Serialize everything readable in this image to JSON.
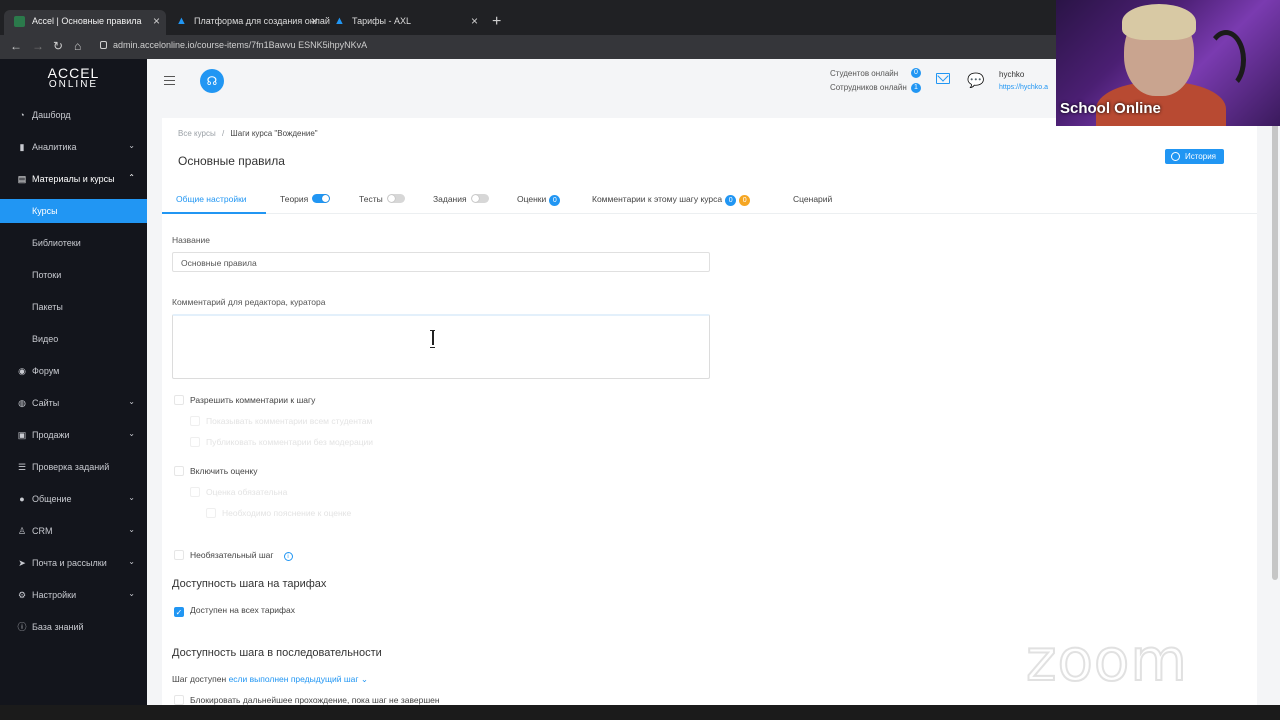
{
  "browser": {
    "tabs": [
      {
        "title": "Accel | Основные правила",
        "active": true
      },
      {
        "title": "Платформа для создания онлай",
        "active": false
      },
      {
        "title": "Тарифы - AXL",
        "active": false
      }
    ],
    "new_tab": "+",
    "url": "admin.accelonline.io/course-items/7fn1Bawvu ESNK5ihpyNKvA"
  },
  "logo": {
    "line1": "ACCEL",
    "line2": "ONLINE"
  },
  "sidebar": {
    "items": [
      {
        "label": "Дашборд",
        "icon": "dashboard-icon"
      },
      {
        "label": "Аналитика",
        "icon": "chart-icon"
      },
      {
        "label": "Материалы и курсы",
        "icon": "book-icon"
      },
      {
        "label": "Курсы"
      },
      {
        "label": "Библиотеки"
      },
      {
        "label": "Потоки"
      },
      {
        "label": "Пакеты"
      },
      {
        "label": "Видео"
      },
      {
        "label": "Форум",
        "icon": "forum-icon"
      },
      {
        "label": "Сайты",
        "icon": "globe-icon"
      },
      {
        "label": "Продажи",
        "icon": "cart-icon"
      },
      {
        "label": "Проверка заданий",
        "icon": "list-icon"
      },
      {
        "label": "Общение",
        "icon": "chat-icon"
      },
      {
        "label": "CRM",
        "icon": "user-icon"
      },
      {
        "label": "Почта и рассылки",
        "icon": "send-icon"
      },
      {
        "label": "Настройки",
        "icon": "gear-icon"
      },
      {
        "label": "База знаний",
        "icon": "info-icon"
      }
    ]
  },
  "topbar": {
    "students_online_label": "Студентов онлайн",
    "students_online_count": "0",
    "staff_online_label": "Сотрудников онлайн",
    "staff_online_count": "1",
    "user_name": "hychko",
    "user_link": "https://hychko.a"
  },
  "page": {
    "breadcrumb_root": "Все курсы",
    "breadcrumb_sep": "/",
    "breadcrumb_current": "Шаги курса \"Вождение\"",
    "title": "Основные правила",
    "history_button": "История"
  },
  "tabs": {
    "general": "Общие настройки",
    "theory": "Теория",
    "tests": "Тесты",
    "tasks": "Задания",
    "grades": "Оценки",
    "grades_count": "0",
    "comments": "Комментарии к этому шагу курса",
    "comments_count_blue": "0",
    "comments_count_orange": "0",
    "scenario": "Сценарий"
  },
  "form": {
    "name_label": "Название",
    "name_value": "Основные правила",
    "comment_label": "Комментарий для редактора, куратора",
    "allow_comments": "Разрешить комментарии к шагу",
    "show_comments_all": "Показывать комментарии всем студентам",
    "publish_without_moderation": "Публиковать комментарии без модерации",
    "enable_grading": "Включить оценку",
    "grade_required": "Оценка обязательна",
    "explanation_required": "Необходимо пояснение к оценке",
    "optional_step": "Необязательный шаг",
    "tariff_section": "Доступность шага на тарифах",
    "all_tariffs": "Доступен на всех тарифах",
    "sequence_section": "Доступность шага в последовательности",
    "step_available_prefix": "Шаг доступен",
    "step_available_link": "если выполнен предыдущий шаг",
    "block_progress": "Блокировать дальнейшее прохождение, пока шаг не завершен"
  },
  "overlay": {
    "webcam_label": "School Online",
    "watermark": "zoom"
  },
  "colors": {
    "accent": "#2196f3",
    "sidebar_bg": "#13151c",
    "warning": "#f5a623"
  }
}
